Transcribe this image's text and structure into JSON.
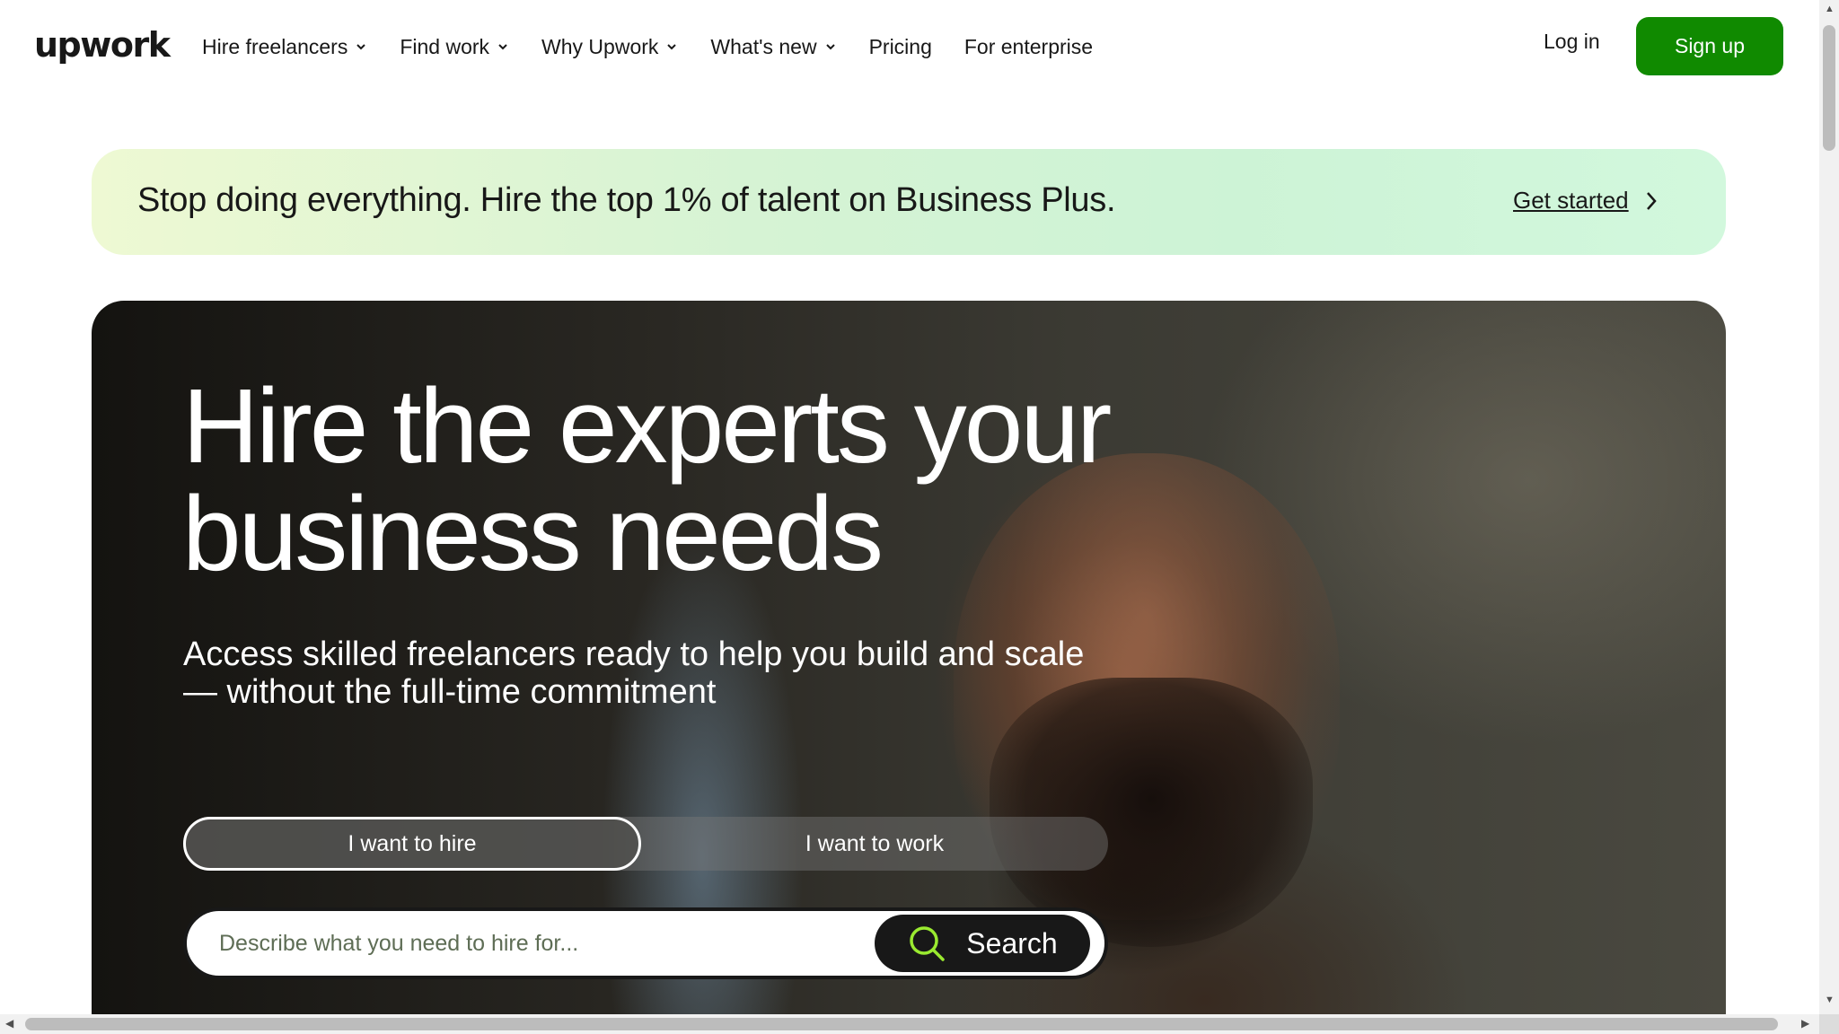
{
  "header": {
    "logo": "upwork",
    "nav": [
      {
        "label": "Hire freelancers",
        "dropdown": true
      },
      {
        "label": "Find work",
        "dropdown": true
      },
      {
        "label": "Why Upwork",
        "dropdown": true
      },
      {
        "label": "What's new",
        "dropdown": true
      },
      {
        "label": "Pricing",
        "dropdown": false
      },
      {
        "label": "For enterprise",
        "dropdown": false
      }
    ],
    "login_label": "Log in",
    "signup_label": "Sign up"
  },
  "banner": {
    "text": "Stop doing everything. Hire the top 1% of talent on Business Plus.",
    "cta_label": "Get started"
  },
  "hero": {
    "title_line1": "Hire the experts your",
    "title_line2": "business needs",
    "subtitle_line1": "Access skilled freelancers ready to help you build and scale",
    "subtitle_line2": "— without the full-time commitment",
    "toggle": {
      "hire_label": "I want to hire",
      "work_label": "I want to work",
      "selected": "hire"
    },
    "search": {
      "placeholder": "Describe what you need to hire for...",
      "value": "",
      "button_label": "Search"
    }
  },
  "colors": {
    "brand_green": "#108a00",
    "accent_lime": "#9aea30",
    "text_dark": "#181818"
  },
  "icons": [
    "chevron-down-icon",
    "chevron-right-icon",
    "search-icon"
  ]
}
